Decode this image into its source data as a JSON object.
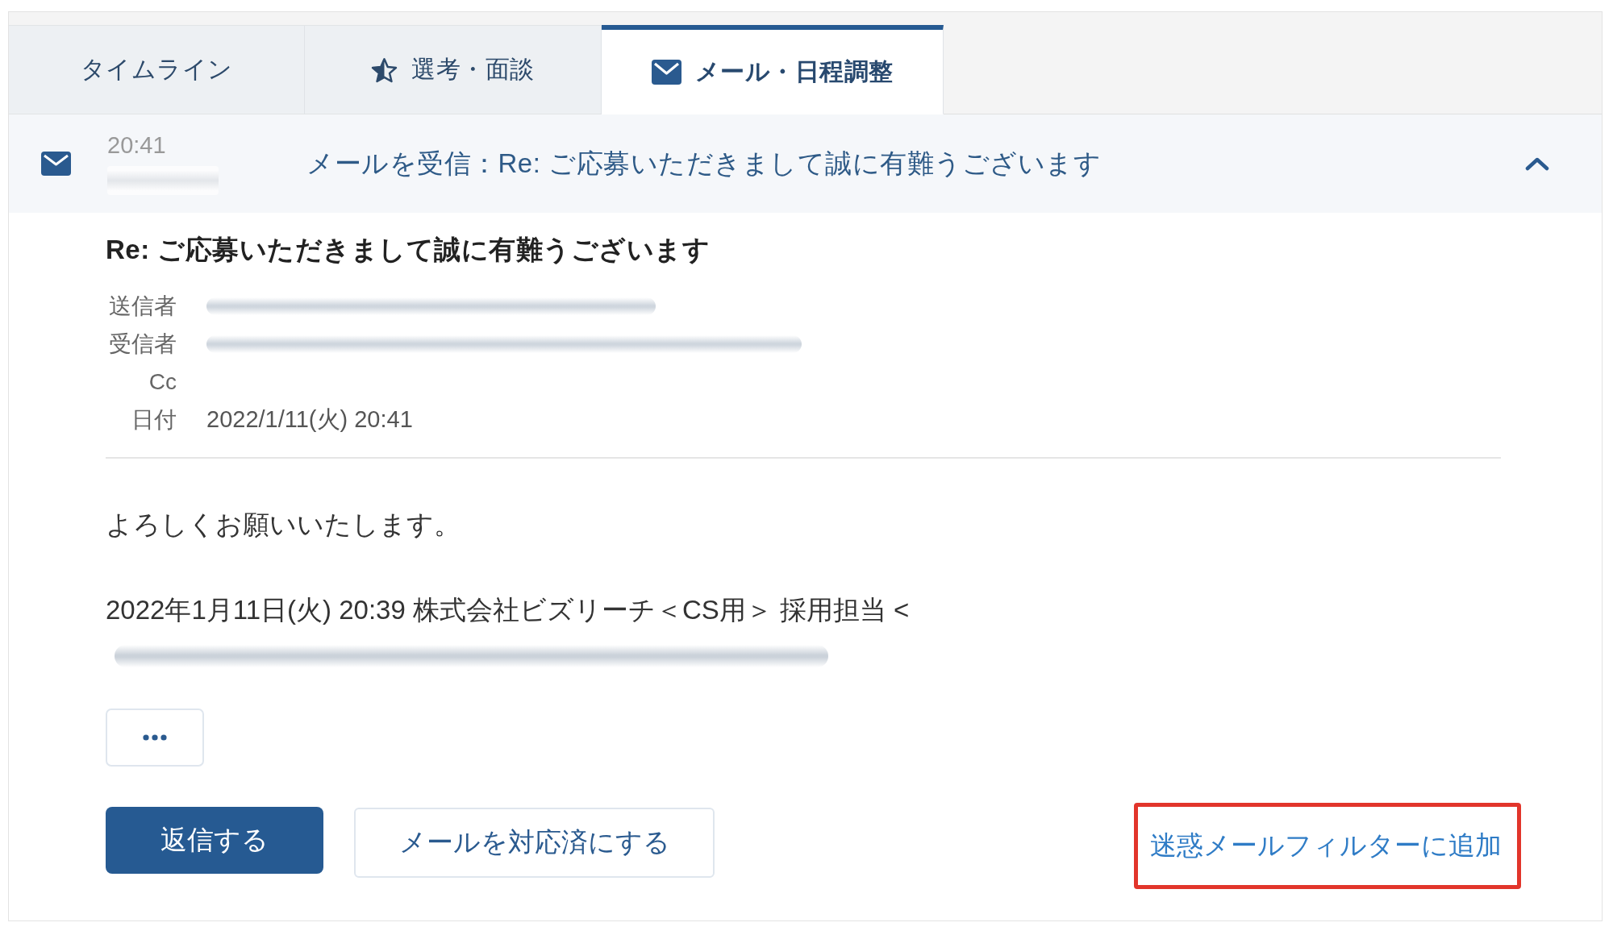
{
  "tabs": [
    {
      "label": "タイムライン",
      "selected": false
    },
    {
      "label": "選考・面談",
      "selected": false
    },
    {
      "label": "メール・日程調整",
      "selected": true
    }
  ],
  "activity": {
    "time": "20:41",
    "sender_redacted": true,
    "title": "メールを受信：Re: ご応募いただきまして誠に有難うございます",
    "expanded": true
  },
  "email": {
    "subject": "Re: ご応募いただきまして誠に有難うございます",
    "headers": [
      {
        "label": "送信者",
        "redacted": true
      },
      {
        "label": "受信者",
        "redacted": true
      },
      {
        "label": "Cc",
        "redacted": false
      },
      {
        "label": "日付",
        "redacted": false,
        "value": "2022/1/11(火) 20:41"
      }
    ],
    "body": [
      {
        "kind": "text",
        "text": "よろしくお願いいたします。"
      },
      {
        "kind": "text",
        "text": "2022年1月11日(火) 20:39 株式会社ビズリーチ＜CS用＞ 採用担当 <"
      },
      {
        "kind": "redacted"
      }
    ]
  },
  "actions": {
    "reply": "返信する",
    "mark_done": "メールを対応済にする",
    "spam_filter": {
      "label": "迷惑メールフィルターに追加",
      "highlighted": true
    }
  }
}
